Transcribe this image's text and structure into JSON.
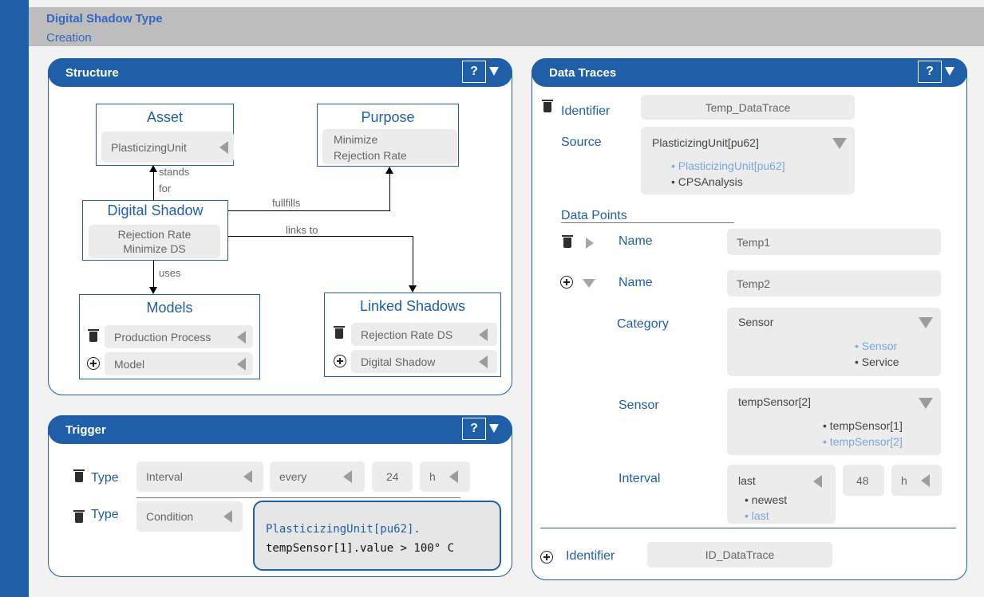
{
  "header": {
    "title": "Digital Shadow Type",
    "subtitle": "Creation"
  },
  "structure": {
    "title": "Structure",
    "help": "?",
    "asset": {
      "title": "Asset",
      "value": "PlasticizingUnit"
    },
    "purpose": {
      "title": "Purpose",
      "line1": "Minimize",
      "line2": "Rejection Rate"
    },
    "digital_shadow": {
      "title": "Digital Shadow",
      "line1": "Rejection Rate",
      "line2": "Minimize DS"
    },
    "models": {
      "title": "Models",
      "item1": "Production Process",
      "item2": "Model"
    },
    "linked": {
      "title": "Linked Shadows",
      "item1": "Rejection Rate DS",
      "item2": "Digital Shadow"
    },
    "edges": {
      "stands1": "stands",
      "stands2": "for",
      "fulfills": "fullfills",
      "links": "links to",
      "uses": "uses"
    }
  },
  "trigger": {
    "title": "Trigger",
    "help": "?",
    "row1": {
      "label": "Type",
      "type": "Interval",
      "every": "every",
      "num": "24",
      "unit": "h"
    },
    "row2": {
      "label": "Type",
      "type": "Condition",
      "code1": "PlasticizingUnit[pu62].",
      "code2": "tempSensor[1].value > 100° C"
    }
  },
  "traces": {
    "title": "Data Traces",
    "help": "?",
    "identifier_label": "Identifier",
    "identifier": "Temp_DataTrace",
    "source_label": "Source",
    "source": "PlasticizingUnit[pu62]",
    "source_opts": [
      "PlasticizingUnit[pu62]",
      "CPSAnalysis"
    ],
    "dp_label": "Data Points",
    "name_label": "Name",
    "name1": "Temp1",
    "name2": "Temp2",
    "category_label": "Category",
    "category": "Sensor",
    "category_opts": [
      "Sensor",
      "Service"
    ],
    "sensor_label": "Sensor",
    "sensor": "tempSensor[2]",
    "sensor_opts": [
      "tempSensor[1]",
      "tempSensor[2]"
    ],
    "interval_label": "Interval",
    "interval": "last",
    "interval_num": "48",
    "interval_unit": "h",
    "interval_opts": [
      "newest",
      "last"
    ],
    "new_identifier_label": "Identifier",
    "new_identifier": "ID_DataTrace"
  }
}
